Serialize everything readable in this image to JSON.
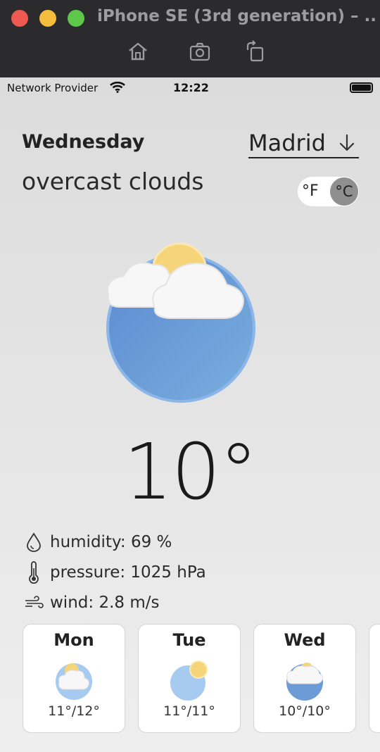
{
  "simulator": {
    "title": "iPhone SE (3rd generation) – ...",
    "tools": [
      "home-icon",
      "screenshot-icon",
      "rotate-icon"
    ]
  },
  "status_bar": {
    "carrier": "Network Provider",
    "time": "12:22"
  },
  "weather": {
    "day": "Wednesday",
    "city": "Madrid",
    "condition": "overcast clouds",
    "unit_f": "°F",
    "unit_c": "°C",
    "selected_unit": "°C",
    "temperature": "10°",
    "details": {
      "humidity": "humidity: 69 %",
      "pressure": "pressure: 1025 hPa",
      "wind": "wind: 2.8 m/s"
    }
  },
  "forecast": [
    {
      "day": "Mon",
      "range": "11°/12°",
      "icon": "cloud-sun-icon"
    },
    {
      "day": "Tue",
      "range": "11°/11°",
      "icon": "sun-icon"
    },
    {
      "day": "Wed",
      "range": "10°/10°",
      "icon": "overcast-icon"
    }
  ],
  "colors": {
    "sun": "#f6d57a",
    "sky_blue": "#6d9bd6",
    "toggle_knob": "#8f8f8f"
  }
}
